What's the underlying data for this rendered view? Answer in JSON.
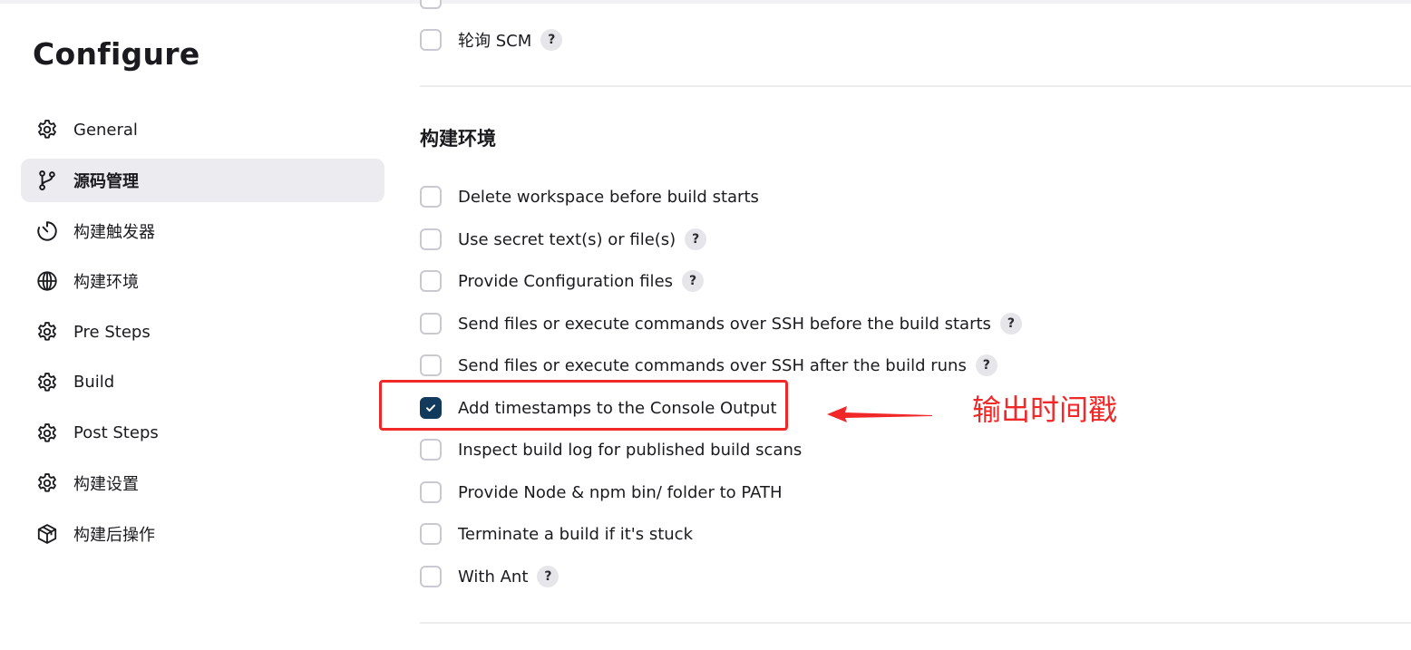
{
  "sidebar": {
    "title": "Configure",
    "items": [
      {
        "label": "General",
        "icon": "gear-icon"
      },
      {
        "label": "源码管理",
        "icon": "git-branch-icon",
        "active": true
      },
      {
        "label": "构建触发器",
        "icon": "timer-icon"
      },
      {
        "label": "构建环境",
        "icon": "globe-icon"
      },
      {
        "label": "Pre Steps",
        "icon": "gear-icon"
      },
      {
        "label": "Build",
        "icon": "gear-icon"
      },
      {
        "label": "Post Steps",
        "icon": "gear-icon"
      },
      {
        "label": "构建设置",
        "icon": "gear-icon"
      },
      {
        "label": "构建后操作",
        "icon": "package-icon"
      }
    ]
  },
  "main": {
    "poll_scm": {
      "label": "轮询 SCM",
      "checked": false,
      "help": "?"
    },
    "build_env": {
      "title": "构建环境",
      "options": [
        {
          "label": "Delete workspace before build starts",
          "checked": false,
          "help": ""
        },
        {
          "label": "Use secret text(s) or file(s)",
          "checked": false,
          "help": "?"
        },
        {
          "label": "Provide Configuration files",
          "checked": false,
          "help": "?"
        },
        {
          "label": "Send files or execute commands over SSH before the build starts",
          "checked": false,
          "help": "?"
        },
        {
          "label": "Send files or execute commands over SSH after the build runs",
          "checked": false,
          "help": "?"
        },
        {
          "label": "Add timestamps to the Console Output",
          "checked": true,
          "help": ""
        },
        {
          "label": "Inspect build log for published build scans",
          "checked": false,
          "help": ""
        },
        {
          "label": "Provide Node & npm bin/ folder to PATH",
          "checked": false,
          "help": ""
        },
        {
          "label": "Terminate a build if it's stuck",
          "checked": false,
          "help": ""
        },
        {
          "label": "With Ant",
          "checked": false,
          "help": "?"
        }
      ]
    }
  },
  "annotation": {
    "text": "输出时间戳",
    "color": "#f02828"
  },
  "colors": {
    "accent": "#123a5c",
    "active_nav_bg": "#ebebf0",
    "annotation_red": "#f02828"
  }
}
